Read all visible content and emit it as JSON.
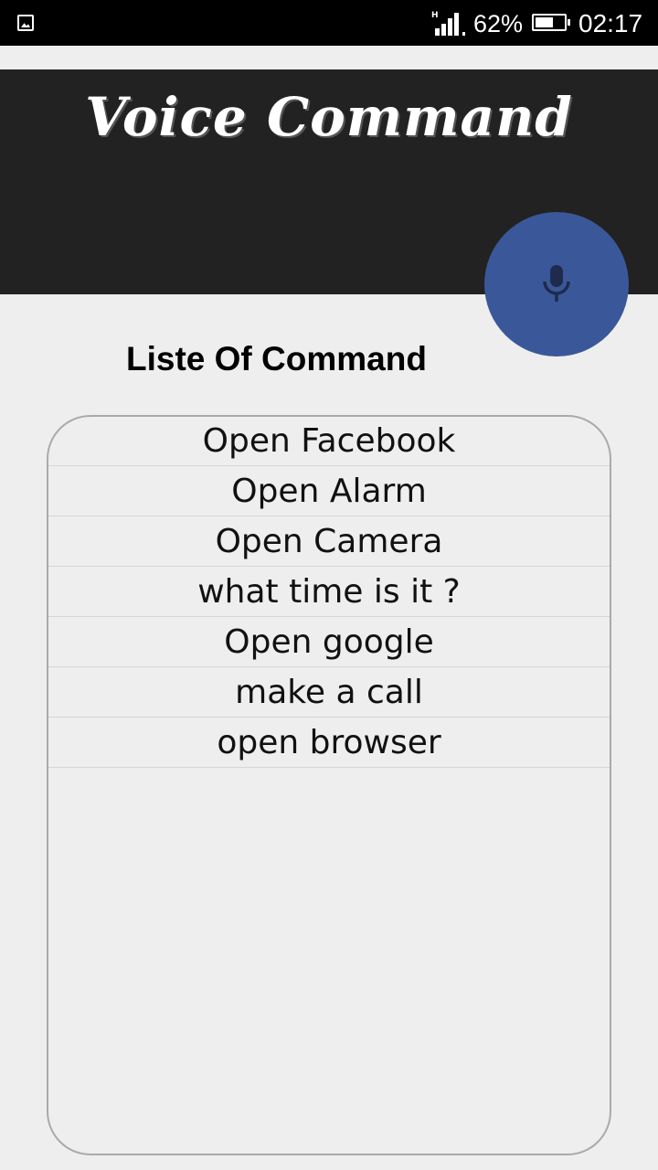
{
  "status_bar": {
    "network_type": "H",
    "battery_percent": "62%",
    "battery_level": 0.62,
    "time": "02:17",
    "left_icon": "image-notification-icon"
  },
  "header": {
    "title": "Voice Command",
    "background_color": "#222222"
  },
  "mic_button": {
    "icon": "microphone-icon",
    "color": "#3a5899"
  },
  "main": {
    "list_heading": "Liste Of Command",
    "commands": [
      "Open Facebook",
      "Open Alarm",
      "Open Camera",
      "what time is it ?",
      "Open google",
      "make a call",
      "open browser"
    ]
  }
}
